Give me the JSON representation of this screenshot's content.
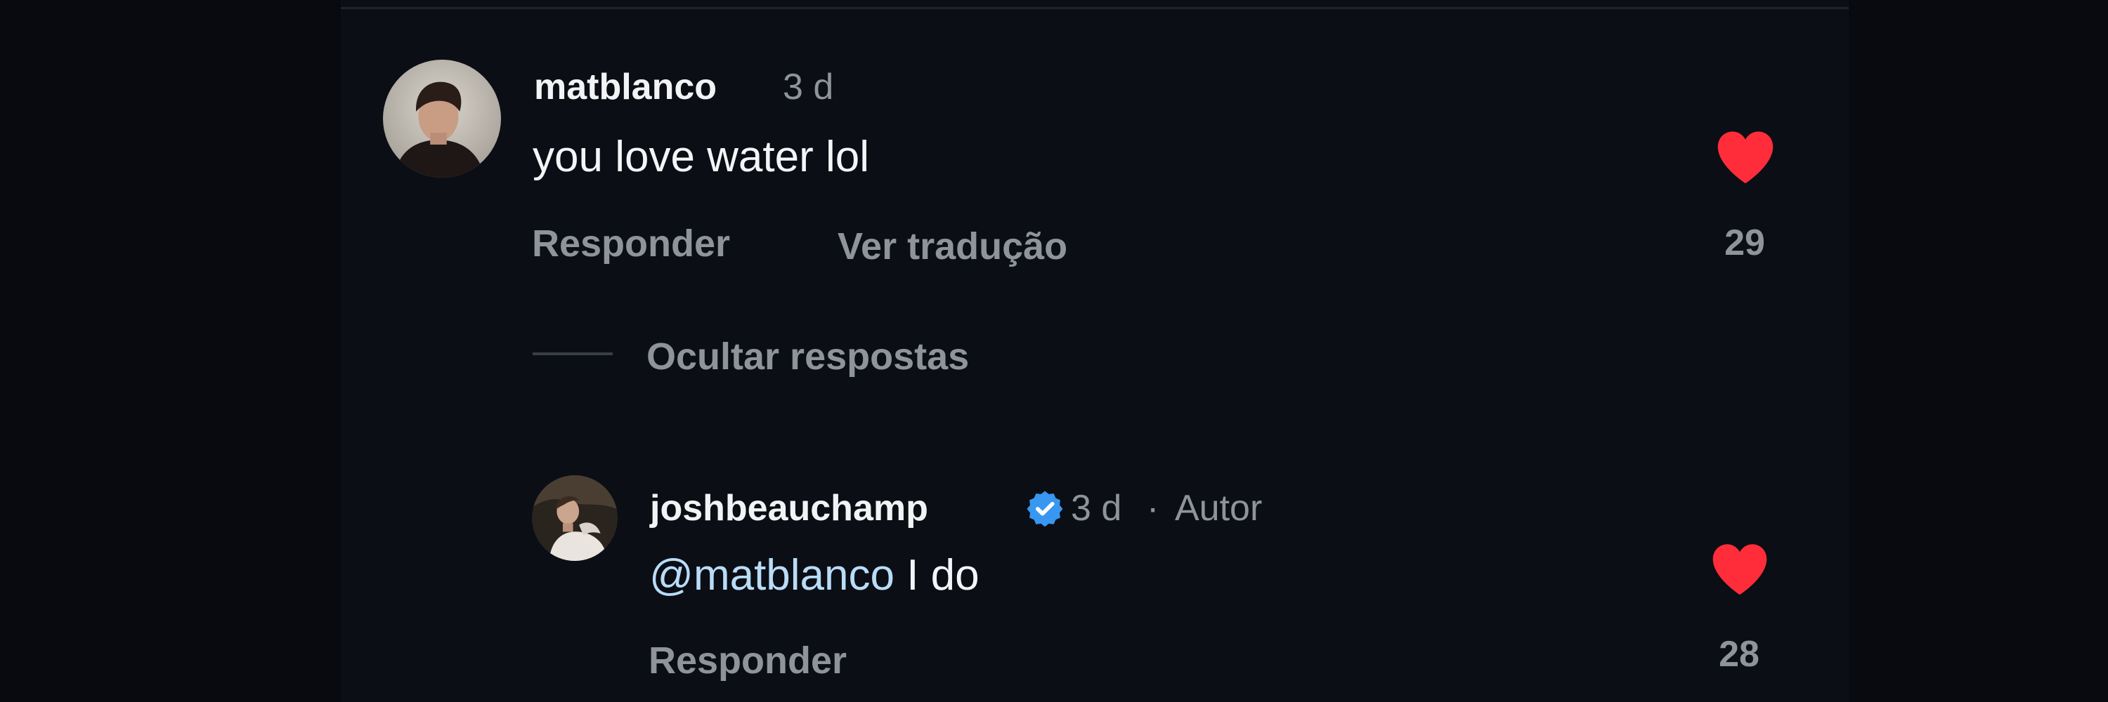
{
  "comment": {
    "username": "matblanco",
    "age": "3 d",
    "text": "you love water lol",
    "reply_label": "Responder",
    "translate_label": "Ver tradução",
    "like_count": "29",
    "liked": true,
    "avatar_icon": "profile-photo"
  },
  "replies_toggle": {
    "label": "Ocultar respostas"
  },
  "reply": {
    "username": "joshbeauchamp",
    "verified": true,
    "age": "3 d",
    "separator": "·",
    "author_tag": "Autor",
    "mention": "@matblanco",
    "text": "I do",
    "reply_label": "Responder",
    "like_count": "28",
    "liked": true,
    "avatar_icon": "profile-photo"
  },
  "colors": {
    "background": "#0b0e15",
    "primary_text": "#f2f3f5",
    "secondary_text": "#8e939c",
    "mention": "#b9dcf7",
    "like_red": "#ff2d3a",
    "verified_blue": "#3897f0"
  }
}
